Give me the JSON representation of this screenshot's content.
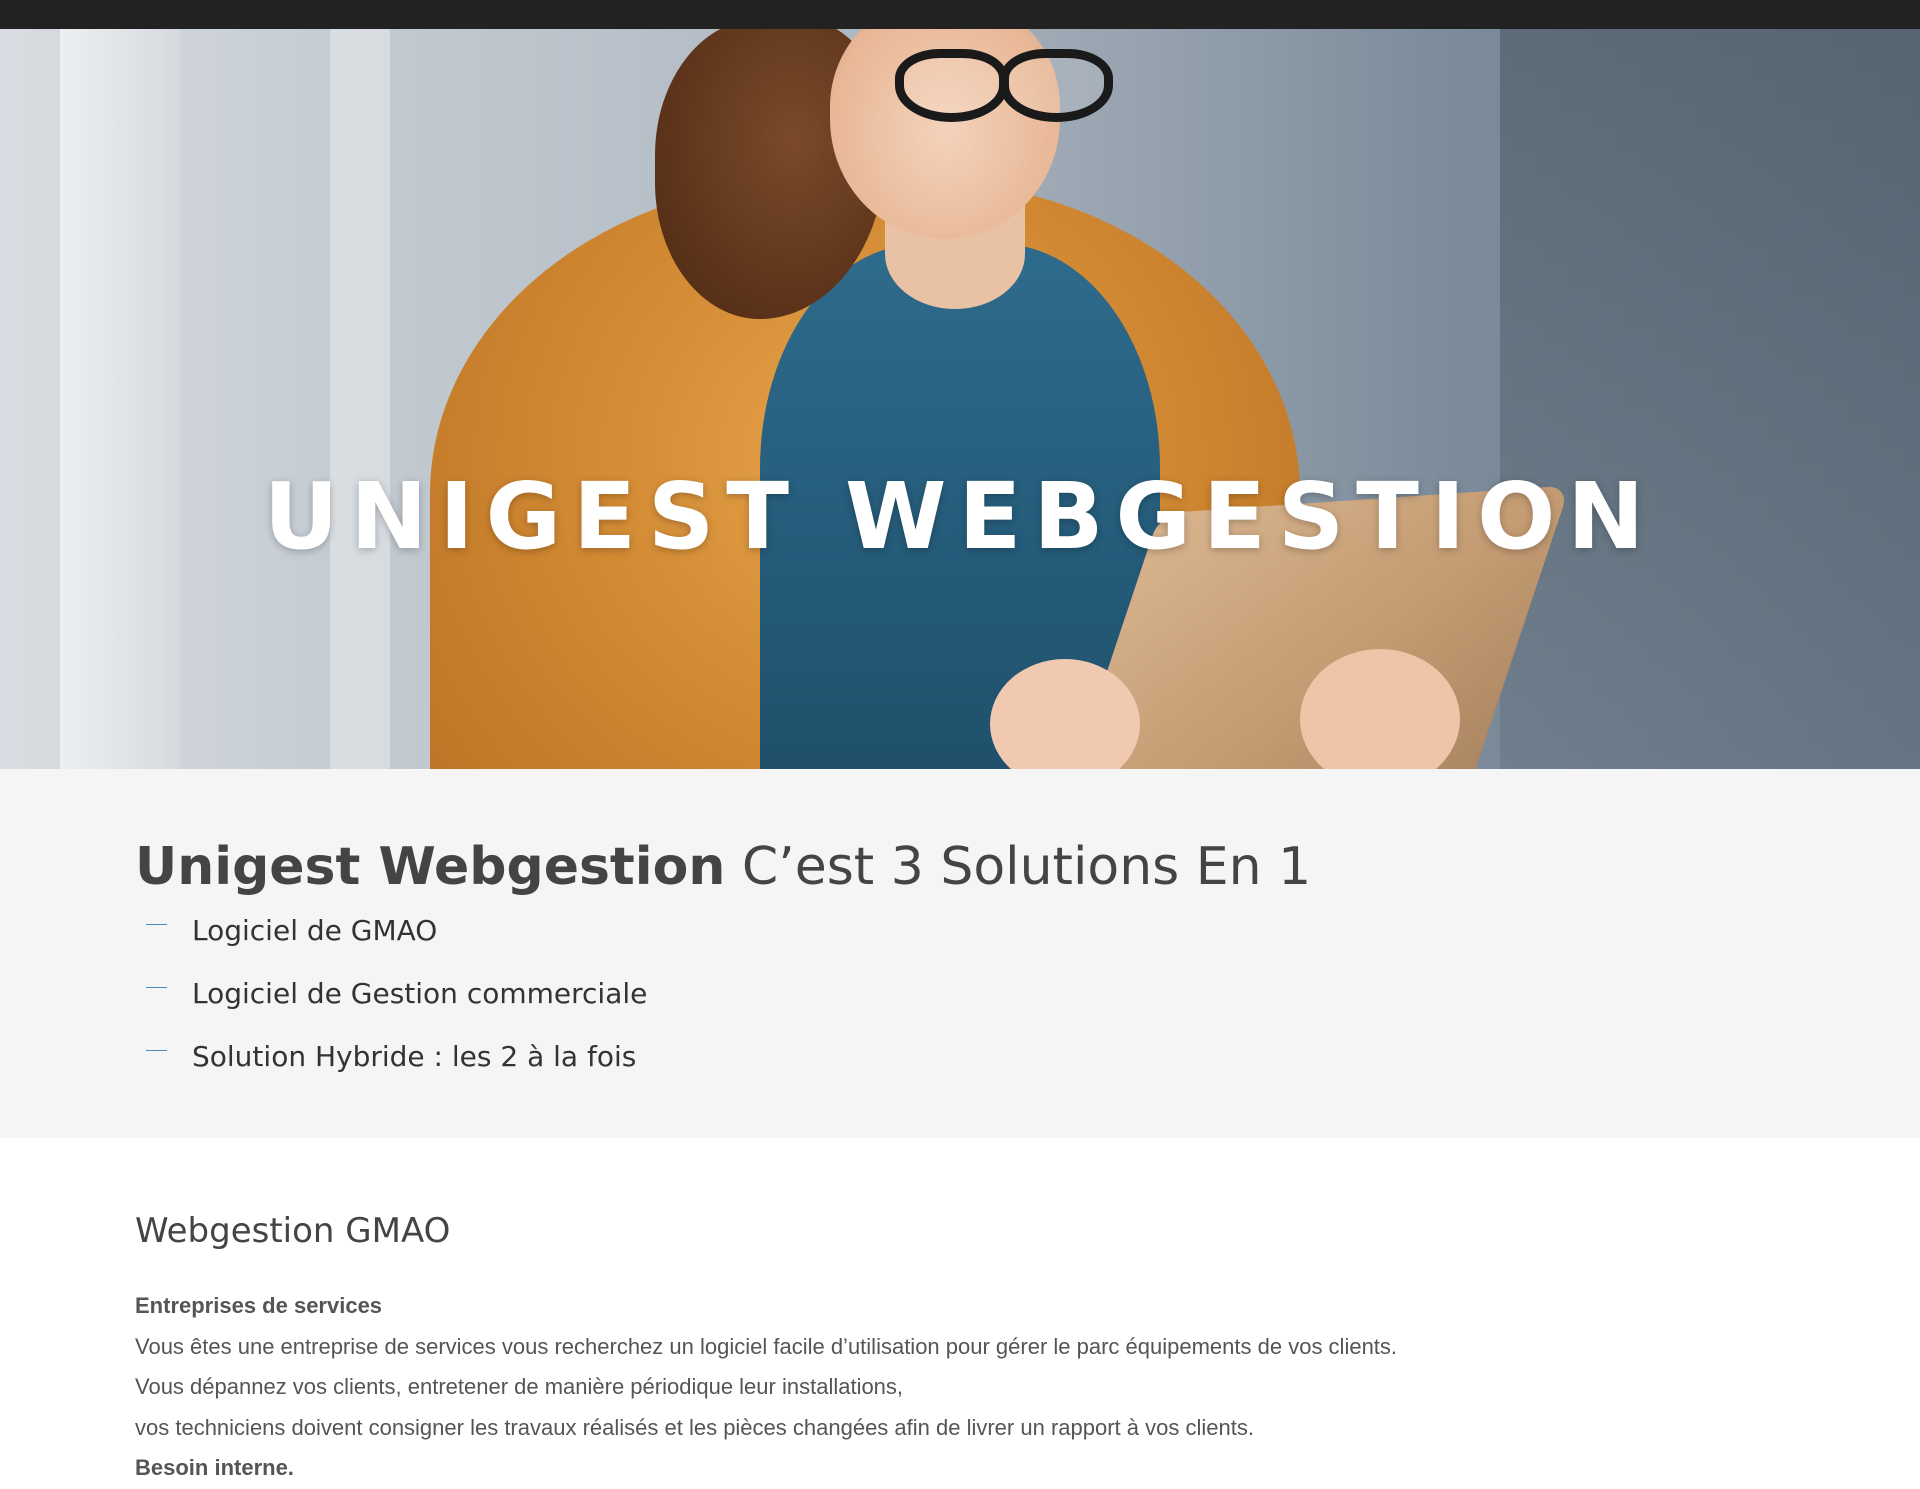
{
  "hero": {
    "title": "UNIGEST WEBGESTION"
  },
  "solutions": {
    "heading_strong": "Unigest Webgestion",
    "heading_rest": " C’est 3 Solutions En 1",
    "items": [
      "Logiciel de GMAO",
      "Logiciel de Gestion commerciale",
      "Solution Hybride : les 2 à la fois"
    ]
  },
  "gmao": {
    "title": "Webgestion GMAO",
    "subhead_services": "Entreprises de services",
    "line1": "Vous êtes une entreprise de services vous recherchez un logiciel facile d’utilisation pour gérer le parc équipements de vos clients.",
    "line2": "Vous dépannez vos clients, entretener de manière périodique leur installations,",
    "line3": "vos techniciens doivent consigner les travaux réalisés et les pièces changées afin de livrer un rapport à vos clients.",
    "subhead_internal": "Besoin interne."
  },
  "colors": {
    "topbar": "#222222",
    "section_bg": "#f5f5f5",
    "dash_accent": "#4a8fc4",
    "heading_text": "#444444"
  }
}
